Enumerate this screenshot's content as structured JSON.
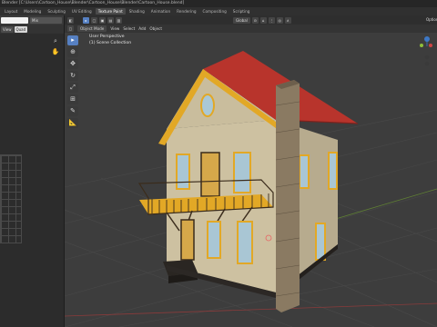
{
  "window": {
    "title": "Blender [C:\\Users\\Cartoon_House\\Blender\\Cartoon_House\\Blender\\Cartoon_House.blend]"
  },
  "workspace_tabs": [
    {
      "label": "Layout"
    },
    {
      "label": "Modeling"
    },
    {
      "label": "Sculpting"
    },
    {
      "label": "UV Editing"
    },
    {
      "label": "Texture Paint",
      "active": true
    },
    {
      "label": "Shading"
    },
    {
      "label": "Animation"
    },
    {
      "label": "Rendering"
    },
    {
      "label": "Compositing"
    },
    {
      "label": "Scripting"
    }
  ],
  "left_panel": {
    "image_dropdown": "Mix",
    "view_button": "View",
    "quad_button": "Quad"
  },
  "viewport": {
    "transform_orientation": "Global",
    "object_mode": "Object Mode",
    "menus": [
      "View",
      "Select",
      "Add",
      "Object"
    ],
    "perspective_label": "User Perspective",
    "collection_label": "(1) Scene Collection",
    "options_label": "Options"
  },
  "icons": {
    "cursor": "cursor-icon",
    "move": "move-icon",
    "rotate": "rotate-icon",
    "scale": "scale-icon",
    "transform": "transform-icon",
    "annotate": "annotate-icon",
    "measure": "measure-icon"
  },
  "colors": {
    "accent": "#5680c2",
    "roof": "#b8342c",
    "wall": "#cfc3a3",
    "trim": "#e2a826",
    "chimney": "#8a7a62",
    "floor_grid": "#494949"
  }
}
